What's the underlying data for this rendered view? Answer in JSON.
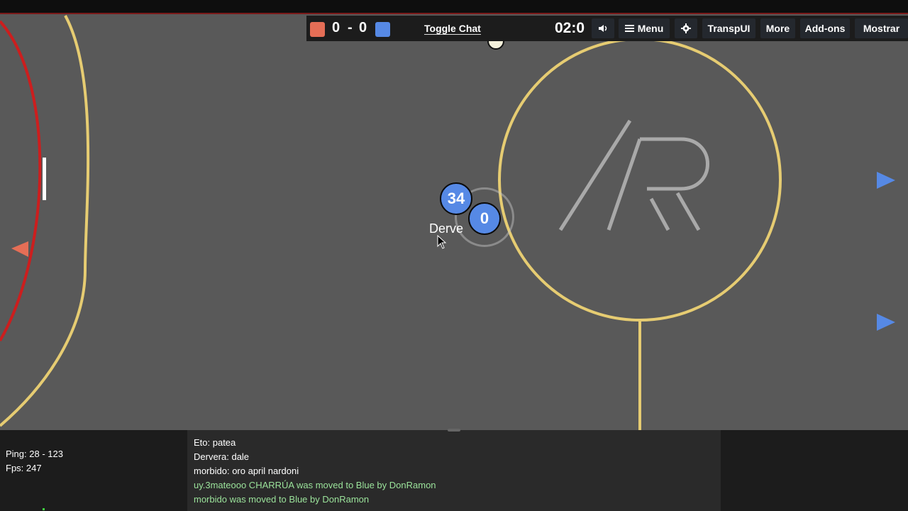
{
  "hud": {
    "score_red": "0",
    "score_sep": "-",
    "score_blue": "0",
    "toggle_chat": "Toggle Chat",
    "timer": "02:0",
    "buttons": {
      "sound_icon": "speaker-icon",
      "menu": "Menu",
      "menu_icon": "hamburger-icon",
      "settings_icon": "gear-icon",
      "transp": "TranspUI",
      "more": "More",
      "addons": "Add-ons",
      "mostrar": "Mostrar"
    },
    "colors": {
      "red_team": "#e56e56",
      "blue_team": "#5689e5"
    }
  },
  "field": {
    "logo_text": "/R",
    "players": [
      {
        "number": "34",
        "team": "blue"
      },
      {
        "number": "0",
        "team": "blue",
        "name": "Derve"
      }
    ]
  },
  "stats": {
    "ping": "Ping: 28 - 123",
    "fps": "Fps: 247"
  },
  "chat": {
    "lines": [
      {
        "text": "Eto: patea",
        "type": "message"
      },
      {
        "text": "Dervera: dale",
        "type": "message"
      },
      {
        "text": "morbido: oro april nardoni",
        "type": "message"
      },
      {
        "text": "uy.3mateooo CHARRÚA was moved to Blue by DonRamon",
        "type": "notice"
      },
      {
        "text": "morbido was moved to Blue by DonRamon",
        "type": "notice"
      }
    ]
  }
}
